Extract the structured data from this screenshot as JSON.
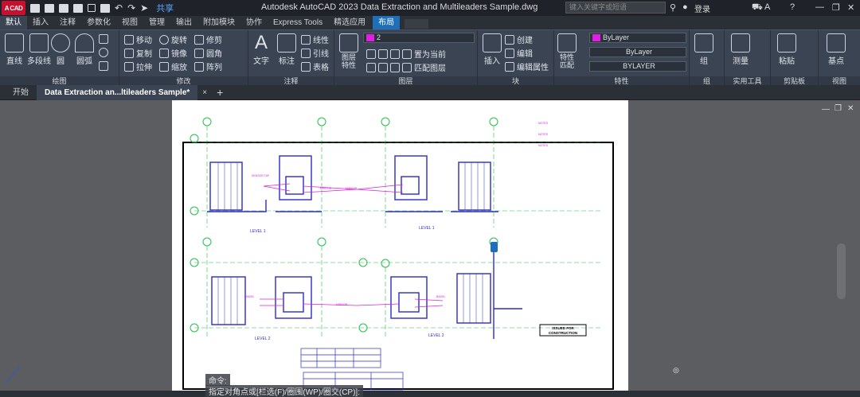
{
  "title": {
    "logo": "A CAD",
    "app_title": "Autodesk AutoCAD 2023    Data Extraction and Multileaders Sample.dwg",
    "share": "共享",
    "search_placeholder": "键入关键字或短语",
    "login": "登录"
  },
  "tabs": [
    "默认",
    "插入",
    "注释",
    "参数化",
    "视图",
    "管理",
    "输出",
    "附加模块",
    "协作",
    "Express Tools",
    "精选应用",
    "布局"
  ],
  "ribbon": {
    "draw": {
      "title": "绘图",
      "line": "直线",
      "polyline": "多段线",
      "circle": "圆",
      "arc": "圆弧"
    },
    "modify": {
      "title": "修改",
      "move": "移动",
      "rotate": "旋转",
      "trim": "修剪",
      "copy": "复制",
      "mirror": "镜像",
      "fillet": "圆角",
      "stretch": "拉伸",
      "scale": "缩放",
      "array": "阵列"
    },
    "annotation": {
      "title": "注释",
      "text": "文字",
      "dimension": "标注",
      "linear": "线性",
      "leader": "引线",
      "table": "表格"
    },
    "layers": {
      "title": "图层",
      "layer_props": "图层\n特性",
      "current_layer": "2",
      "make_current": "置为当前",
      "match_layer": "匹配图层"
    },
    "block": {
      "title": "块",
      "insert": "插入",
      "create": "创建",
      "edit": "编辑",
      "edit_attr": "编辑属性"
    },
    "properties": {
      "title": "特性",
      "match": "特性\n匹配",
      "color": "ByLayer",
      "linetype": "ByLayer",
      "lineweight": "BYLAYER"
    },
    "groups": {
      "title": "组",
      "group": "组"
    },
    "utilities": {
      "title": "实用工具",
      "measure": "测量"
    },
    "clipboard": {
      "title": "剪贴板",
      "paste": "粘贴"
    },
    "view": {
      "title": "视图",
      "base": "基点"
    }
  },
  "doc_tabs": {
    "start": "开始",
    "current": "Data Extraction an...ltileaders Sample*",
    "close": "×",
    "new": "+"
  },
  "drawing": {
    "label_level1a": "LEVEL 1",
    "label_level1b": "LEVEL 1",
    "label_level2a": "LEVEL 2",
    "label_level2b": "LEVEL 2",
    "stamp_line1": "ISSUED FOR",
    "stamp_line2": "CONSTRUCTION"
  },
  "command": {
    "line1": "命令:",
    "line2": "指定对角点或[栏选(F)/圈围(WP)/圈交(CP)]:"
  },
  "colors": {
    "accent": "#1e6fb8",
    "drawing_blue": "#2b2bd0",
    "drawing_magenta": "#e020e0",
    "drawing_green": "#25c04a"
  }
}
